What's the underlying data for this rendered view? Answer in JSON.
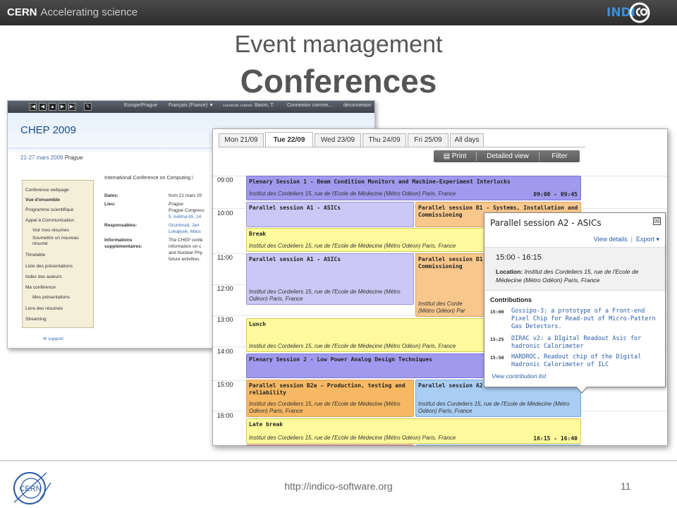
{
  "header": {
    "org": "CERN",
    "tagline": "Accelerating science",
    "logo_text": "INDI",
    "logo_accent": "#3a8fd8"
  },
  "slide": {
    "title": "Event management",
    "subtitle": "Conferences"
  },
  "footer": {
    "url": "http://indico-software.org",
    "page_number": "11",
    "logo_text": "CERN"
  },
  "conference_page": {
    "toolbar": {
      "timezone": "Europe/Prague",
      "language": "Français (France) ▼",
      "connected_as": "connecté comme",
      "user": "Baron, T.",
      "login": "Connexion comme...",
      "logout": "déconnexion"
    },
    "title": "CHEP 2009",
    "dates": "21-27 mars 2009",
    "place": "Prague",
    "side_menu": [
      "Conference webpage",
      "Vue d'ensemble",
      "Programme scientifique",
      "Appel à Communication",
      "Voir mes résumés",
      "Soumettre un nouveau",
      "résumé",
      "Timetable",
      "Liste des présentations",
      "Index des auteurs",
      "Ma conférence",
      "Mes présentations",
      "Livre des résumés",
      "Streaming"
    ],
    "support": "support",
    "intro": "International Conference on Computing i",
    "info_labels": {
      "dates": "Dates:",
      "place": "Lieu:",
      "responsible": "Responsables:",
      "more_info_1": "Informations",
      "more_info_2": "supplémentaires:"
    },
    "info_values": {
      "dates": "from 21 mars 20",
      "place_1": "Prague",
      "place_2": "Prague Congress",
      "place_3": "5. května 65, 14",
      "resp_1": "Gruntorad, Jan",
      "resp_2": "Lokajicek, Milos",
      "more_1": "The CHEP confe",
      "more_2": "information on c",
      "more_3": "and Nuclear Phy",
      "more_4": "future activities."
    }
  },
  "timetable": {
    "tabs": [
      "Mon 21/09",
      "Tue 22/09",
      "Wed 23/09",
      "Thu 24/09",
      "Fri 25/09",
      "All days"
    ],
    "active_tab": "Tue 22/09",
    "toolbar": {
      "print": "Print",
      "detailed": "Detailed view",
      "filter": "Filter"
    },
    "hours": [
      "09:00",
      "10:00",
      "11:00",
      "12:00",
      "13:00",
      "14:00",
      "15:00",
      "16:00"
    ],
    "blocks": {
      "plenary1": {
        "title": "Plenary Session 1 - Beam Condition Monitors and Machine-Experiment Interlocks",
        "location": "Institut des Cordeliers 15, rue de l'Ecole de Médecine (Métro Odéon) Paris, France",
        "time": "09:00 - 09:45"
      },
      "a1_first": {
        "title": "Parallel session A1 - ASICs"
      },
      "b1_first": {
        "title": "Parallel session B1 - Systems, Installation and Commissioning"
      },
      "break": {
        "title": "Break",
        "location": "Institut des Cordeliers 15, rue de l'Ecole de Médecine (Métro Odéon) Paris, France"
      },
      "a1_second": {
        "title": "Parallel session A1 - ASICs",
        "location": "Institut des Cordeliers 15, rue de l'Ecole de Médecine (Métro Odéon) Paris, France"
      },
      "b1_second": {
        "title_1": "Parallel session B1",
        "title_2": "Commissioning",
        "location_1": "Institut des Corde",
        "location_2": "(Métro Odéon) Par"
      },
      "lunch": {
        "title": "Lunch",
        "location": "Institut des Cordeliers 15, rue de l'Ecole de Médecine (Métro Odéon) Paris, France"
      },
      "plenary2": {
        "title": "Plenary Session 2 - Low Power Analog Design Techniques"
      },
      "b2a": {
        "title": "Parallel session B2a - Production, testing and reliability",
        "location": "Institut des Cordeliers 15, rue de l'Ecole de Médecine (Métro Odéon) Paris, France"
      },
      "a2": {
        "title": "Parallel session A2",
        "location": "Institut des Cordeliers 15, rue de l'Ecole de Médecine (Métro Odéon) Paris, France"
      },
      "late_break": {
        "title": "Late break",
        "location": "Institut des Cordeliers 15, rue de l'Ecole de Médecine (Métro Odéon) Paris, France",
        "time": "16:15 - 16:40"
      }
    },
    "colors": {
      "plenary": "#a09aee",
      "asics": "#cbc8f5",
      "systems": "#f8c78c",
      "break": "#fffa9c",
      "a2": "#a9cdf3",
      "red": "#f07d6b"
    }
  },
  "popup": {
    "title": "Parallel session A2 - ASICs",
    "close": "☒",
    "view_details": "View details",
    "export": "Export",
    "time": "15:00 - 16:15",
    "location_label": "Location:",
    "location": "Institut des Cordeliers 15, rue de l'Ecole de Médecine (Métro Odéon) Paris, France",
    "contributions_label": "Contributions",
    "contributions": [
      {
        "time": "15:00",
        "title": "Gossipo-3: a prototype of a Front-end Pixel Chip for Read-out of Micro-Pattern Gas Detectors."
      },
      {
        "time": "15:25",
        "title": "DIRAC v2: a DIgital Readout Asic for hadronic Calorimeter"
      },
      {
        "time": "15:50",
        "title": "HARDROC, Readout chip of the Digital Hadronic Calorimeter of ILC"
      }
    ],
    "view_list": "View contribution list"
  }
}
